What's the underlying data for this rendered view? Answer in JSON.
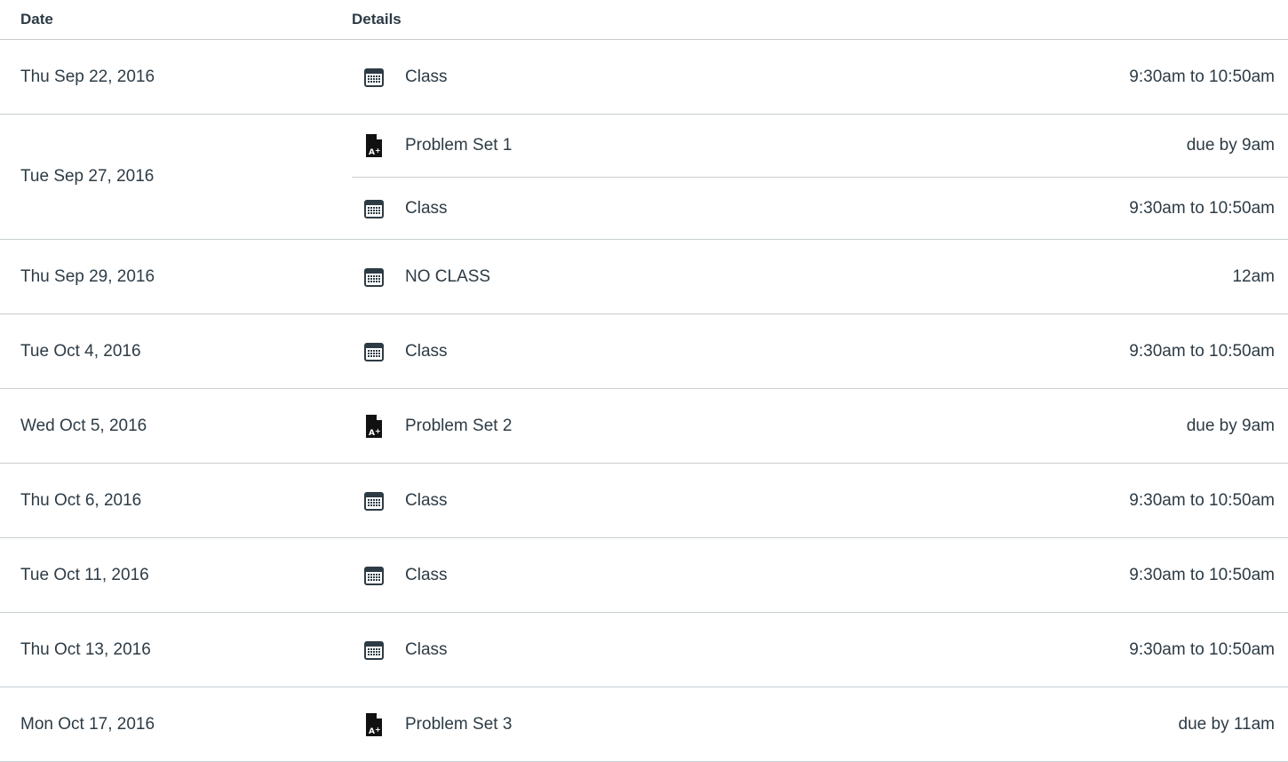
{
  "headers": {
    "date": "Date",
    "details": "Details"
  },
  "rows": [
    {
      "date": "Thu Sep 22, 2016",
      "events": [
        {
          "icon": "calendar-icon",
          "title": "Class",
          "time": "9:30am to 10:50am"
        }
      ]
    },
    {
      "date": "Tue Sep 27, 2016",
      "events": [
        {
          "icon": "assignment-icon",
          "title": "Problem Set 1",
          "time": "due by 9am"
        },
        {
          "icon": "calendar-icon",
          "title": "Class",
          "time": "9:30am to 10:50am"
        }
      ]
    },
    {
      "date": "Thu Sep 29, 2016",
      "events": [
        {
          "icon": "calendar-icon",
          "title": "NO CLASS",
          "time": "12am"
        }
      ]
    },
    {
      "date": "Tue Oct 4, 2016",
      "events": [
        {
          "icon": "calendar-icon",
          "title": "Class",
          "time": "9:30am to 10:50am"
        }
      ]
    },
    {
      "date": "Wed Oct 5, 2016",
      "events": [
        {
          "icon": "assignment-icon",
          "title": "Problem Set 2",
          "time": "due by 9am"
        }
      ]
    },
    {
      "date": "Thu Oct 6, 2016",
      "events": [
        {
          "icon": "calendar-icon",
          "title": "Class",
          "time": "9:30am to 10:50am"
        }
      ]
    },
    {
      "date": "Tue Oct 11, 2016",
      "events": [
        {
          "icon": "calendar-icon",
          "title": "Class",
          "time": "9:30am to 10:50am"
        }
      ]
    },
    {
      "date": "Thu Oct 13, 2016",
      "events": [
        {
          "icon": "calendar-icon",
          "title": "Class",
          "time": "9:30am to 10:50am"
        }
      ]
    },
    {
      "date": "Mon Oct 17, 2016",
      "events": [
        {
          "icon": "assignment-icon",
          "title": "Problem Set 3",
          "time": "due by 11am"
        }
      ]
    }
  ]
}
